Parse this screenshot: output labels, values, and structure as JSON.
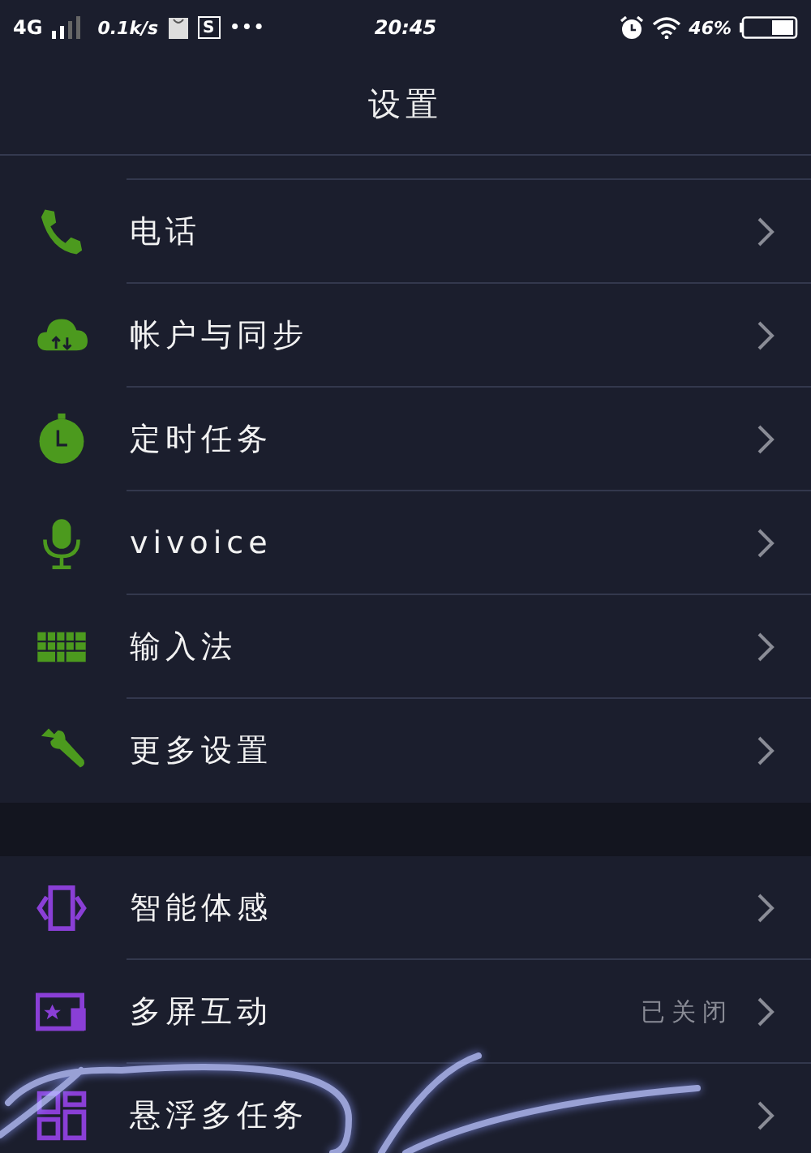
{
  "status_bar": {
    "network": "4G",
    "speed": "0.1k/s",
    "notification_letter": "S",
    "more": "•••",
    "time": "20:45",
    "battery": "46%"
  },
  "title": "设置",
  "sections": [
    {
      "items": [
        {
          "kind": "phone",
          "color": "#4c9a1e",
          "label": "电话"
        },
        {
          "kind": "cloud",
          "color": "#4c9a1e",
          "label": "帐户与同步"
        },
        {
          "kind": "timer",
          "color": "#4c9a1e",
          "label": "定时任务"
        },
        {
          "kind": "mic",
          "color": "#4c9a1e",
          "label": "vivoice"
        },
        {
          "kind": "keyboard",
          "color": "#4c9a1e",
          "label": "输入法"
        },
        {
          "kind": "wrench",
          "color": "#4c9a1e",
          "label": "更多设置"
        }
      ]
    },
    {
      "items": [
        {
          "kind": "tilt",
          "color": "#8a3fd6",
          "label": "智能体感"
        },
        {
          "kind": "screens",
          "color": "#8a3fd6",
          "label": "多屏互动",
          "value": "已关闭"
        },
        {
          "kind": "windows",
          "color": "#8a3fd6",
          "label": "悬浮多任务"
        }
      ]
    }
  ]
}
